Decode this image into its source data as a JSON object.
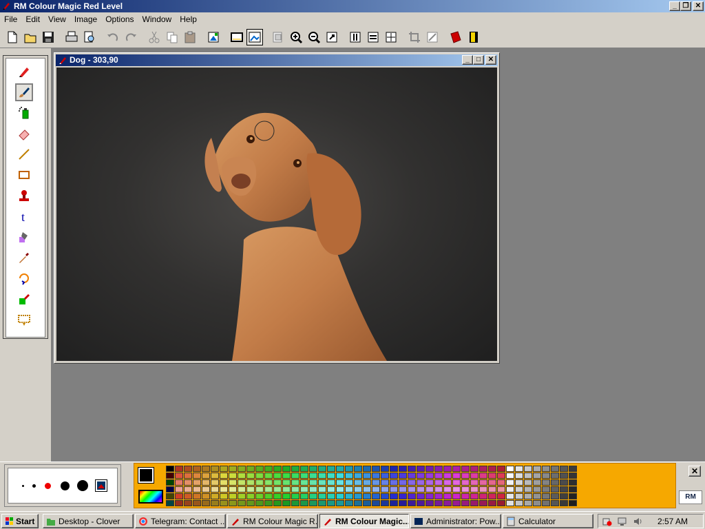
{
  "window": {
    "title": "RM Colour Magic  Red Level"
  },
  "menu": [
    "File",
    "Edit",
    "View",
    "Image",
    "Options",
    "Window",
    "Help"
  ],
  "toolbar": {
    "buttons": [
      "new-file",
      "open-file",
      "save",
      "print",
      "print-preview",
      "undo",
      "redo",
      "cut",
      "copy",
      "paste",
      "paste-special",
      "frame-select",
      "frame-image",
      "copy-image",
      "zoom-in",
      "zoom-out",
      "rotate",
      "flip-horizontal",
      "flip-vertical",
      "fit-window",
      "crop",
      "resize",
      "book",
      "exit"
    ],
    "active": [
      "frame-image"
    ]
  },
  "tools": [
    "pencil",
    "paintbrush",
    "spray-can",
    "eraser",
    "line",
    "rectangle",
    "stamp",
    "text",
    "fill-bucket",
    "eyedropper",
    "rotate-shape",
    "color-picker",
    "marquee-select"
  ],
  "selected_tool": "paintbrush",
  "document": {
    "title": "Dog - 303,90",
    "image_alt": "Vizsla dog tilting head against dark grey background"
  },
  "brush_sizes": [
    "tiny",
    "small",
    "medium",
    "large",
    "extra-large",
    "custom"
  ],
  "palette": {
    "foreground": "#000000",
    "background": "#ffffff",
    "accent": "#f6a800"
  },
  "taskbar": {
    "start_label": "Start",
    "items": [
      {
        "label": "Desktop - Clover"
      },
      {
        "label": "Telegram: Contact ..."
      },
      {
        "label": "RM Colour Magic  R..."
      },
      {
        "label": "RM Colour Magic..."
      },
      {
        "label": "Administrator: Pow..."
      },
      {
        "label": "Calculator"
      }
    ],
    "clock": "2:57 AM"
  }
}
